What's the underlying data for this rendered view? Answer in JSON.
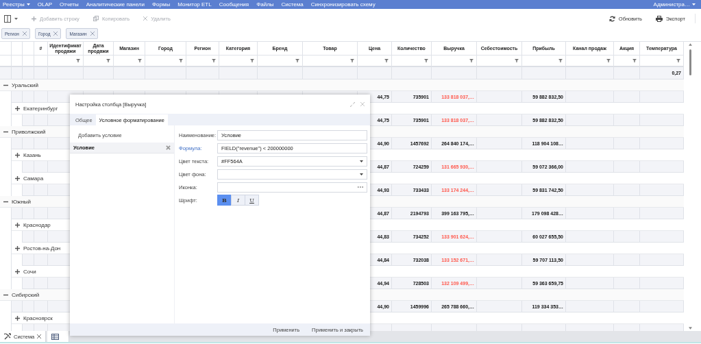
{
  "menu": {
    "items": [
      {
        "label": "Реестры",
        "dropdown": true
      },
      {
        "label": "OLAP",
        "dropdown": false
      },
      {
        "label": "Отчеты",
        "dropdown": false
      },
      {
        "label": "Аналитические панели",
        "dropdown": false
      },
      {
        "label": "Формы",
        "dropdown": false
      },
      {
        "label": "Монитор ETL",
        "dropdown": false
      },
      {
        "label": "Сообщения",
        "dropdown": false
      },
      {
        "label": "Файлы",
        "dropdown": false
      },
      {
        "label": "Система",
        "dropdown": false
      },
      {
        "label": "Синхронизировать схему",
        "dropdown": false
      }
    ],
    "user": {
      "label": "Администра…",
      "dropdown": true
    }
  },
  "toolbar": {
    "left": [
      {
        "kind": "columns",
        "dropdown": true,
        "disabled": false
      },
      {
        "kind": "plus",
        "label": "Добавить строку",
        "disabled": true
      },
      {
        "kind": "copy",
        "label": "Копировать",
        "disabled": true
      },
      {
        "kind": "close",
        "label": "Удалить",
        "disabled": true
      }
    ],
    "right": [
      {
        "kind": "refresh",
        "label": "Обновить",
        "disabled": false
      },
      {
        "kind": "printer",
        "label": "Экспорт",
        "disabled": false
      }
    ]
  },
  "group_chips": [
    {
      "label": "Регион"
    },
    {
      "label": "Город"
    },
    {
      "label": "Магазин"
    }
  ],
  "table": {
    "columns": [
      {
        "label": "#",
        "filter": false
      },
      {
        "label": "Идентификат продажи",
        "filter": true
      },
      {
        "label": "Дата продажи",
        "filter": true
      },
      {
        "label": "Магазин",
        "filter": true
      },
      {
        "label": "Город",
        "filter": true
      },
      {
        "label": "Регион",
        "filter": true
      },
      {
        "label": "Категория",
        "filter": true
      },
      {
        "label": "Бренд",
        "filter": true
      },
      {
        "label": "Товар",
        "filter": true
      },
      {
        "label": "Цена",
        "filter": true
      },
      {
        "label": "Количество",
        "filter": true
      },
      {
        "label": "Выручка",
        "filter": true
      },
      {
        "label": "Себестоимость",
        "filter": true
      },
      {
        "label": "Прибыль",
        "filter": true
      },
      {
        "label": "Канал продаж",
        "filter": true
      },
      {
        "label": "Акция",
        "filter": true
      },
      {
        "label": "Температура",
        "filter": true
      }
    ],
    "summary": {
      "temperature": "0,27"
    },
    "rows": [
      {
        "kind": "group",
        "label": "Уральский",
        "expanded": true
      },
      {
        "kind": "group_total",
        "price": "44,75",
        "quantity": "735901",
        "revenue": "133 818 037,…",
        "revenue_flagged": true,
        "profit": "59 882 832,50"
      },
      {
        "kind": "city",
        "label": "Екатеринбург",
        "expanded": false
      },
      {
        "kind": "city_total",
        "price": "44,75",
        "quantity": "735901",
        "revenue": "133 818 037,…",
        "revenue_flagged": true,
        "profit": "59 882 832,50"
      },
      {
        "kind": "group",
        "label": "Приволжский",
        "expanded": true
      },
      {
        "kind": "group_total",
        "price": "44,90",
        "quantity": "1457692",
        "revenue": "264 840 174,…",
        "revenue_flagged": false,
        "profit": "118 904 108…"
      },
      {
        "kind": "city",
        "label": "Казань",
        "expanded": false
      },
      {
        "kind": "city_total",
        "price": "44,87",
        "quantity": "724259",
        "revenue": "131 665 930,…",
        "revenue_flagged": true,
        "profit": "59 072 366,00"
      },
      {
        "kind": "city",
        "label": "Самара",
        "expanded": false
      },
      {
        "kind": "city_total",
        "price": "44,93",
        "quantity": "733433",
        "revenue": "133 174 244,…",
        "revenue_flagged": true,
        "profit": "59 831 742,50"
      },
      {
        "kind": "group",
        "label": "Южный",
        "expanded": true
      },
      {
        "kind": "group_total",
        "price": "44,87",
        "quantity": "2194793",
        "revenue": "399 163 795,…",
        "revenue_flagged": false,
        "profit": "179 098 428…"
      },
      {
        "kind": "city",
        "label": "Краснодар",
        "expanded": false
      },
      {
        "kind": "city_total",
        "price": "44,83",
        "quantity": "734252",
        "revenue": "133 901 624,…",
        "revenue_flagged": true,
        "profit": "60 027 655,50"
      },
      {
        "kind": "city",
        "label": "Ростов-на-Дон",
        "expanded": false
      },
      {
        "kind": "city_total",
        "price": "44,84",
        "quantity": "732038",
        "revenue": "133 152 671,…",
        "revenue_flagged": true,
        "profit": "59 707 113,50"
      },
      {
        "kind": "city",
        "label": "Сочи",
        "expanded": false
      },
      {
        "kind": "city_total",
        "price": "44,94",
        "quantity": "728503",
        "revenue": "132 109 499,…",
        "revenue_flagged": true,
        "profit": "59 363 659,75"
      },
      {
        "kind": "group",
        "label": "Сибирский",
        "expanded": true
      },
      {
        "kind": "group_total",
        "price": "44,90",
        "quantity": "1459996",
        "revenue": "265 788 660,…",
        "revenue_flagged": false,
        "profit": "119 334 353…"
      },
      {
        "kind": "city",
        "label": "Красноярск",
        "expanded": false
      },
      {
        "kind": "city_total"
      }
    ]
  },
  "dialog": {
    "title": "Настройка столбца [Выручка]",
    "tabs": [
      {
        "label": "Общее",
        "selected": false
      },
      {
        "label": "Условное форматирование",
        "selected": true
      }
    ],
    "add_condition": "Добавить условие",
    "conditions": [
      {
        "label": "Условие",
        "selected": true
      }
    ],
    "fields": [
      {
        "label": "Наименование:",
        "kind": "text",
        "value": "Условие",
        "highlighted": false
      },
      {
        "label": "Формула:",
        "kind": "text",
        "value": "FIELD(\"revenue\") < 200000000",
        "highlighted": true
      },
      {
        "label": "Цвет текста:",
        "kind": "select",
        "value": "#FF564A",
        "highlighted": false
      },
      {
        "label": "Цвет фона:",
        "kind": "select",
        "highlighted": false
      },
      {
        "label": "Иконка:",
        "kind": "picker",
        "highlighted": false
      },
      {
        "label": "Шрифт:",
        "kind": "font",
        "highlighted": false
      }
    ],
    "font_buttons": [
      {
        "label": "B",
        "kind": "bold",
        "selected": true
      },
      {
        "label": "I",
        "kind": "italic",
        "selected": false
      },
      {
        "label": "U",
        "kind": "underline",
        "selected": false
      }
    ],
    "buttons": [
      {
        "label": "Применить"
      },
      {
        "label": "Применить и закрыть"
      }
    ]
  },
  "taskbar": {
    "tabs": [
      {
        "label": "Система",
        "kind": "tools",
        "closable": true
      },
      {
        "kind": "table",
        "closable": false
      }
    ]
  }
}
